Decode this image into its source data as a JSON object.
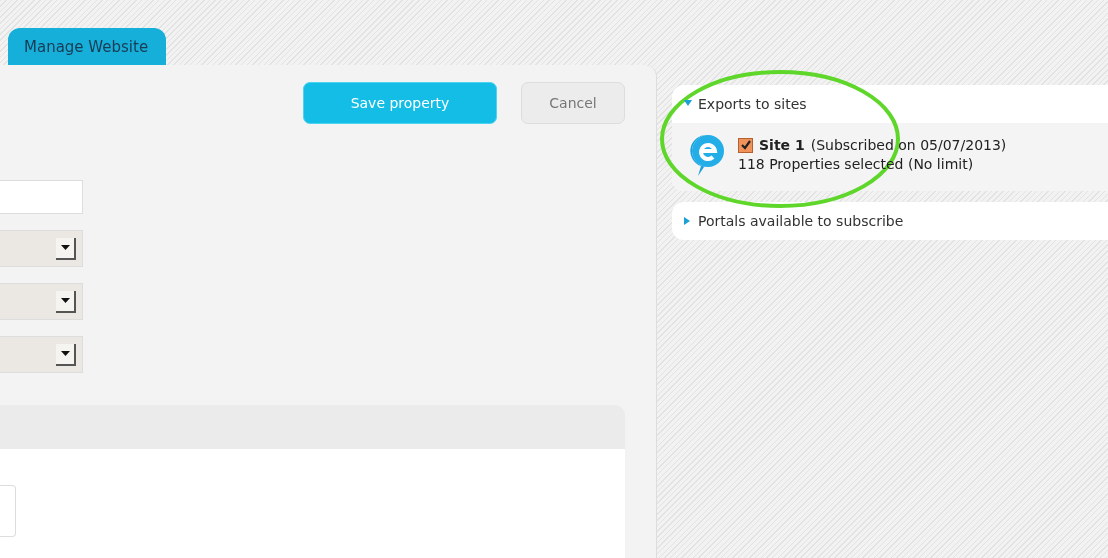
{
  "tabs": [
    {
      "label": "Manage Website",
      "selected": true
    }
  ],
  "buttons": [
    {
      "label": "Save property",
      "kind": "primary"
    },
    {
      "label": "Cancel",
      "kind": "secondary"
    }
  ],
  "fields": [
    {
      "kind": "text"
    },
    {
      "kind": "select"
    },
    {
      "kind": "select"
    },
    {
      "kind": "select"
    }
  ],
  "sections": [
    {
      "title": "Exports to sites",
      "expanded": true,
      "sites": [
        {
          "name": "Site 1",
          "detail": "(Subscribed on 05/07/2013)",
          "checked": true,
          "summary": "118 Properties selected (No limit)"
        }
      ]
    },
    {
      "title": "Portals available to subscribe",
      "expanded": false
    }
  ],
  "annotation": {
    "kind": "ellipse"
  }
}
